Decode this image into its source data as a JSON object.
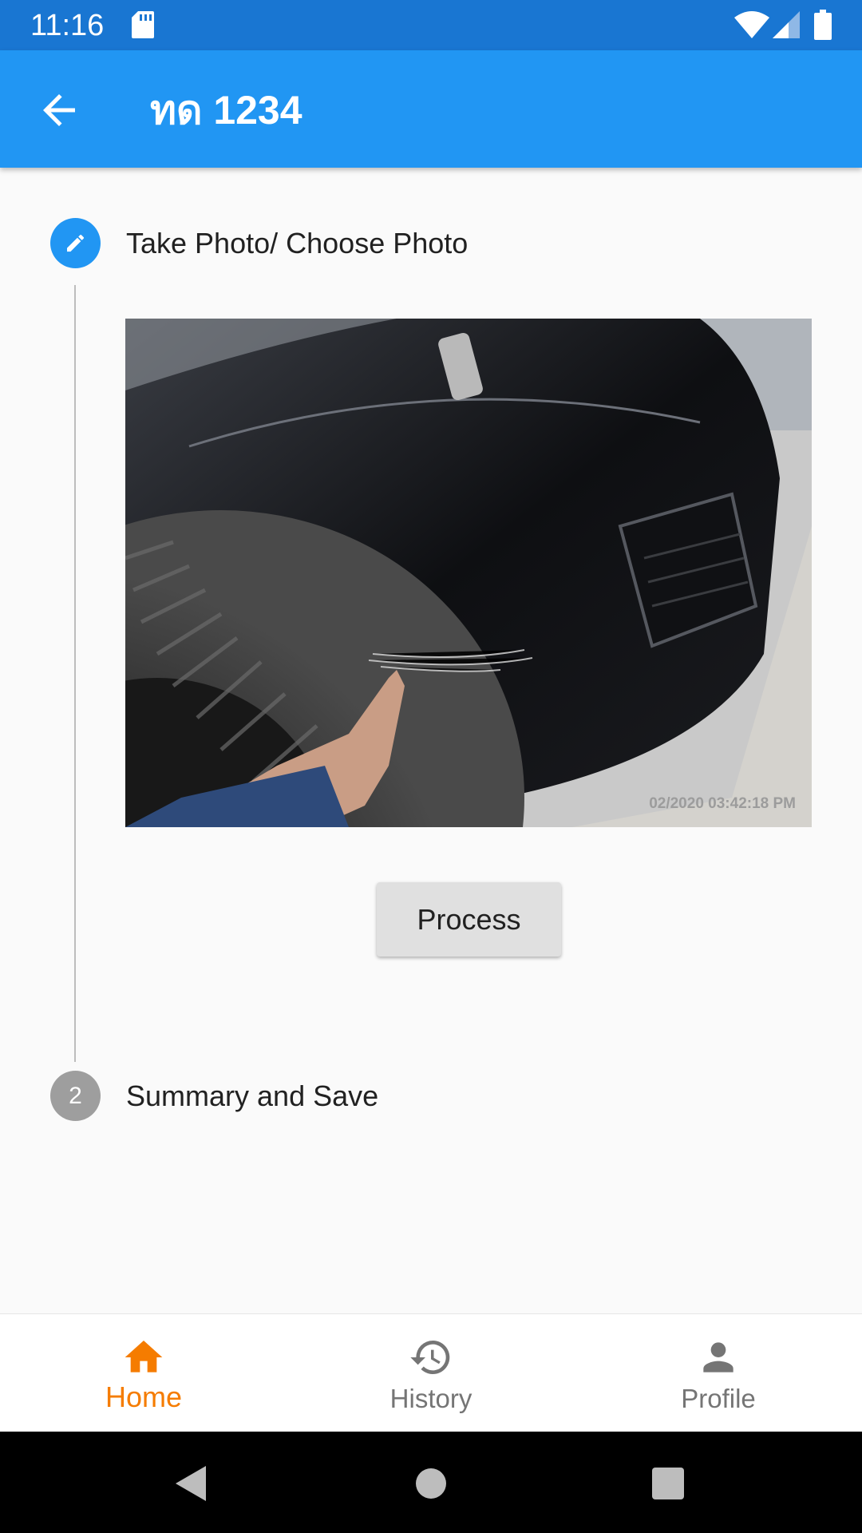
{
  "status_bar": {
    "time": "11:16"
  },
  "app_bar": {
    "title": "ทด 1234"
  },
  "steps": [
    {
      "label": "Take Photo/ Choose Photo",
      "state": "editing"
    },
    {
      "number": "2",
      "label": "Summary and Save",
      "state": "pending"
    }
  ],
  "photo": {
    "timestamp": "02/2020 03:42:18 PM"
  },
  "process_button": {
    "label": "Process"
  },
  "bottom_nav": {
    "items": [
      {
        "label": "Home",
        "icon": "home-icon",
        "active": true
      },
      {
        "label": "History",
        "icon": "history-icon",
        "active": false
      },
      {
        "label": "Profile",
        "icon": "person-icon",
        "active": false
      }
    ]
  },
  "colors": {
    "status_bar": "#1976d2",
    "app_bar": "#2196f3",
    "active_nav": "#f57c00",
    "inactive_step": "#9e9e9e"
  }
}
